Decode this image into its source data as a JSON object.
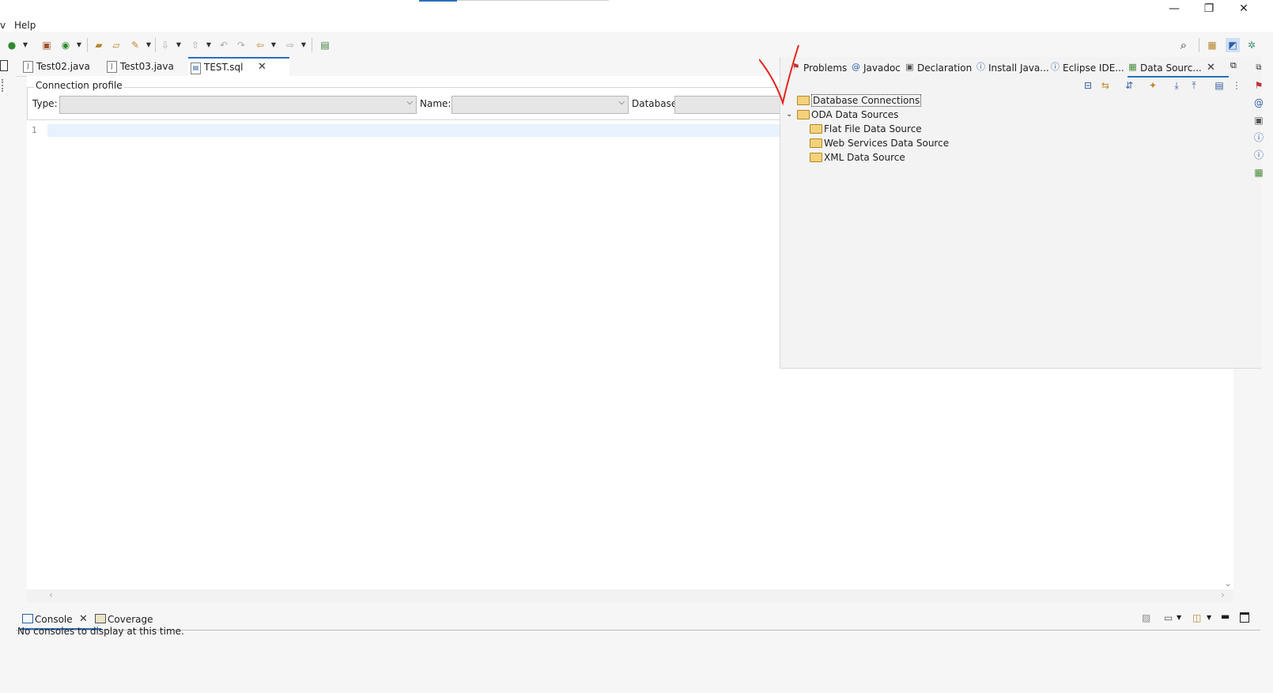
{
  "window": {
    "minimize": "—",
    "restore": "❐",
    "close": "✕"
  },
  "menu": {
    "partial": "v",
    "help": "Help"
  },
  "editor_tabs": [
    {
      "label": "Test02.java",
      "icon": "java-file-icon"
    },
    {
      "label": "Test03.java",
      "icon": "java-file-icon"
    },
    {
      "label": "TEST.sql",
      "icon": "sql-file-icon",
      "active": true
    }
  ],
  "connection_profile": {
    "group_label": "Connection profile",
    "type_label": "Type:",
    "type_value": "",
    "name_label": "Name:",
    "name_value": "",
    "database_label": "Database:",
    "database_value": ""
  },
  "editor": {
    "line_number": "1"
  },
  "view_tabs": [
    {
      "label": "Problems",
      "icon": "problems-icon"
    },
    {
      "label": "Javadoc",
      "icon": "at-icon",
      "glyph": "@"
    },
    {
      "label": "Declaration",
      "icon": "declaration-icon"
    },
    {
      "label": "Install Java...",
      "icon": "info-icon",
      "glyph": "ⓘ"
    },
    {
      "label": "Eclipse IDE...",
      "icon": "info-icon",
      "glyph": "ⓘ"
    },
    {
      "label": "Data Sourc...",
      "icon": "data-source-icon",
      "active": true
    }
  ],
  "data_source_tree": [
    {
      "label": "Database Connections",
      "level": 0,
      "selected": true
    },
    {
      "label": "ODA Data Sources",
      "level": 0,
      "expanded": true
    },
    {
      "label": "Flat File Data Source",
      "level": 1
    },
    {
      "label": "Web Services Data Source",
      "level": 1
    },
    {
      "label": "XML Data Source",
      "level": 1
    }
  ],
  "console_tabs": [
    {
      "label": "Console",
      "icon": "console-icon",
      "active": true
    },
    {
      "label": "Coverage",
      "icon": "coverage-icon"
    }
  ],
  "console": {
    "message": "No consoles to display at this time."
  },
  "colors": {
    "accent": "#2a6fbf",
    "annotation": "#e3231b",
    "editor_bg": "#ffffff",
    "panel_bg": "#f3f3f3"
  }
}
